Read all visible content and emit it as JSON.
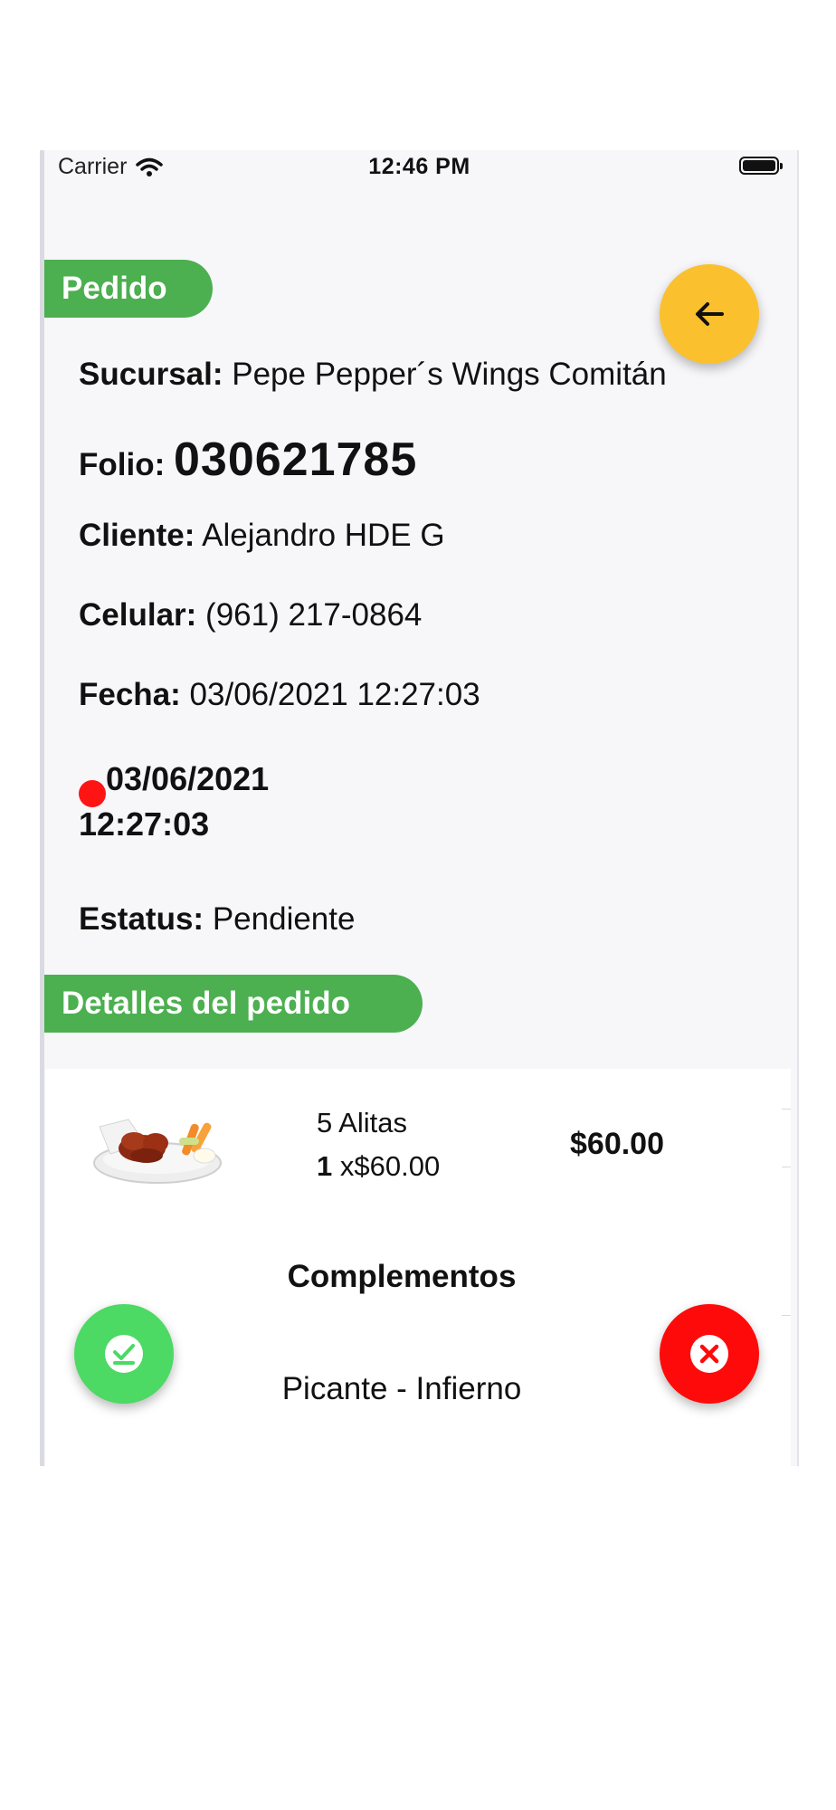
{
  "status_bar": {
    "carrier": "Carrier",
    "time": "12:46 PM"
  },
  "header": {
    "section_label": "Pedido",
    "back_icon": "arrow-left-icon"
  },
  "order": {
    "branch_label": "Sucursal:",
    "branch_value": "Pepe Pepper´s Wings Comitán",
    "folio_label": "Folio:",
    "folio_value": "030621785",
    "client_label": "Cliente:",
    "client_value": "Alejandro HDE G",
    "phone_label": "Celular:",
    "phone_value": "(961) 217-0864",
    "date_label": "Fecha:",
    "date_value": "03/06/2021 12:27:03",
    "alert_date": "03/06/2021",
    "alert_time": "12:27:03",
    "status_label": "Estatus:",
    "status_value": "Pendiente"
  },
  "details": {
    "section_label": "Detalles del pedido",
    "items": [
      {
        "image": "chicken-wings-image",
        "name": "5 Alitas",
        "quantity": "1",
        "unit_price": "x$60.00",
        "total": "$60.00"
      }
    ],
    "complements_title": "Complementos",
    "complements": [
      "Picante - Infierno"
    ]
  },
  "actions": {
    "accept_icon": "check-badge-icon",
    "cancel_icon": "close-circle-icon"
  },
  "colors": {
    "accent_green": "#4caf50",
    "back_fab": "#fbc02d",
    "accept_fab": "#4cd964",
    "cancel_fab": "#ff0a0a",
    "alert_dot": "#ff1414"
  }
}
